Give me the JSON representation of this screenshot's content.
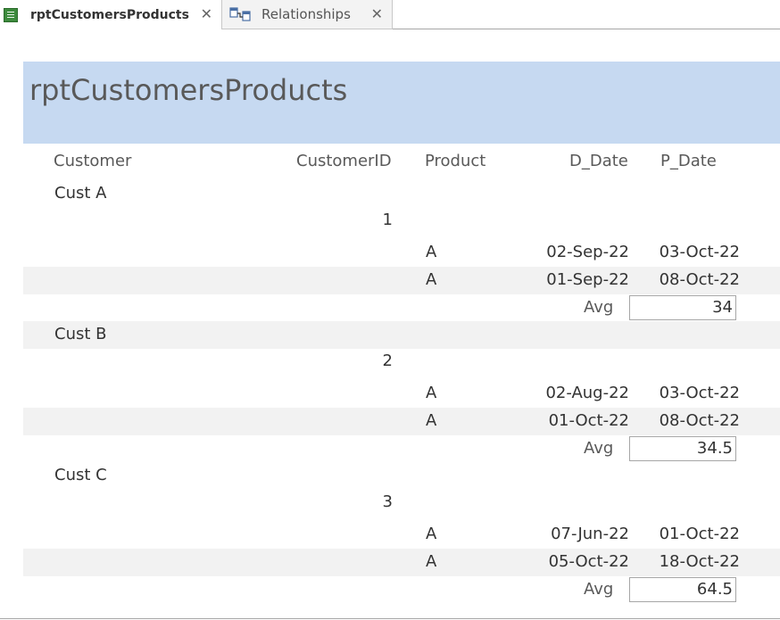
{
  "tabs": [
    {
      "label": "rptCustomersProducts",
      "active": true
    },
    {
      "label": "Relationships",
      "active": false
    }
  ],
  "report": {
    "title": "rptCustomersProducts",
    "columns": {
      "customer": "Customer",
      "customer_id": "CustomerID",
      "product": "Product",
      "d_date": "D_Date",
      "p_date": "P_Date"
    },
    "avg_label": "Avg",
    "groups": [
      {
        "customer": "Cust A",
        "customer_id": "1",
        "rows": [
          {
            "product": "A",
            "d_date": "02-Sep-22",
            "p_date": "03-Oct-22"
          },
          {
            "product": "A",
            "d_date": "01-Sep-22",
            "p_date": "08-Oct-22"
          }
        ],
        "avg": "34"
      },
      {
        "customer": "Cust B",
        "customer_id": "2",
        "rows": [
          {
            "product": "A",
            "d_date": "02-Aug-22",
            "p_date": "03-Oct-22"
          },
          {
            "product": "A",
            "d_date": "01-Oct-22",
            "p_date": "08-Oct-22"
          }
        ],
        "avg": "34.5"
      },
      {
        "customer": "Cust C",
        "customer_id": "3",
        "rows": [
          {
            "product": "A",
            "d_date": "07-Jun-22",
            "p_date": "01-Oct-22"
          },
          {
            "product": "A",
            "d_date": "05-Oct-22",
            "p_date": "18-Oct-22"
          }
        ],
        "avg": "64.5"
      }
    ]
  }
}
